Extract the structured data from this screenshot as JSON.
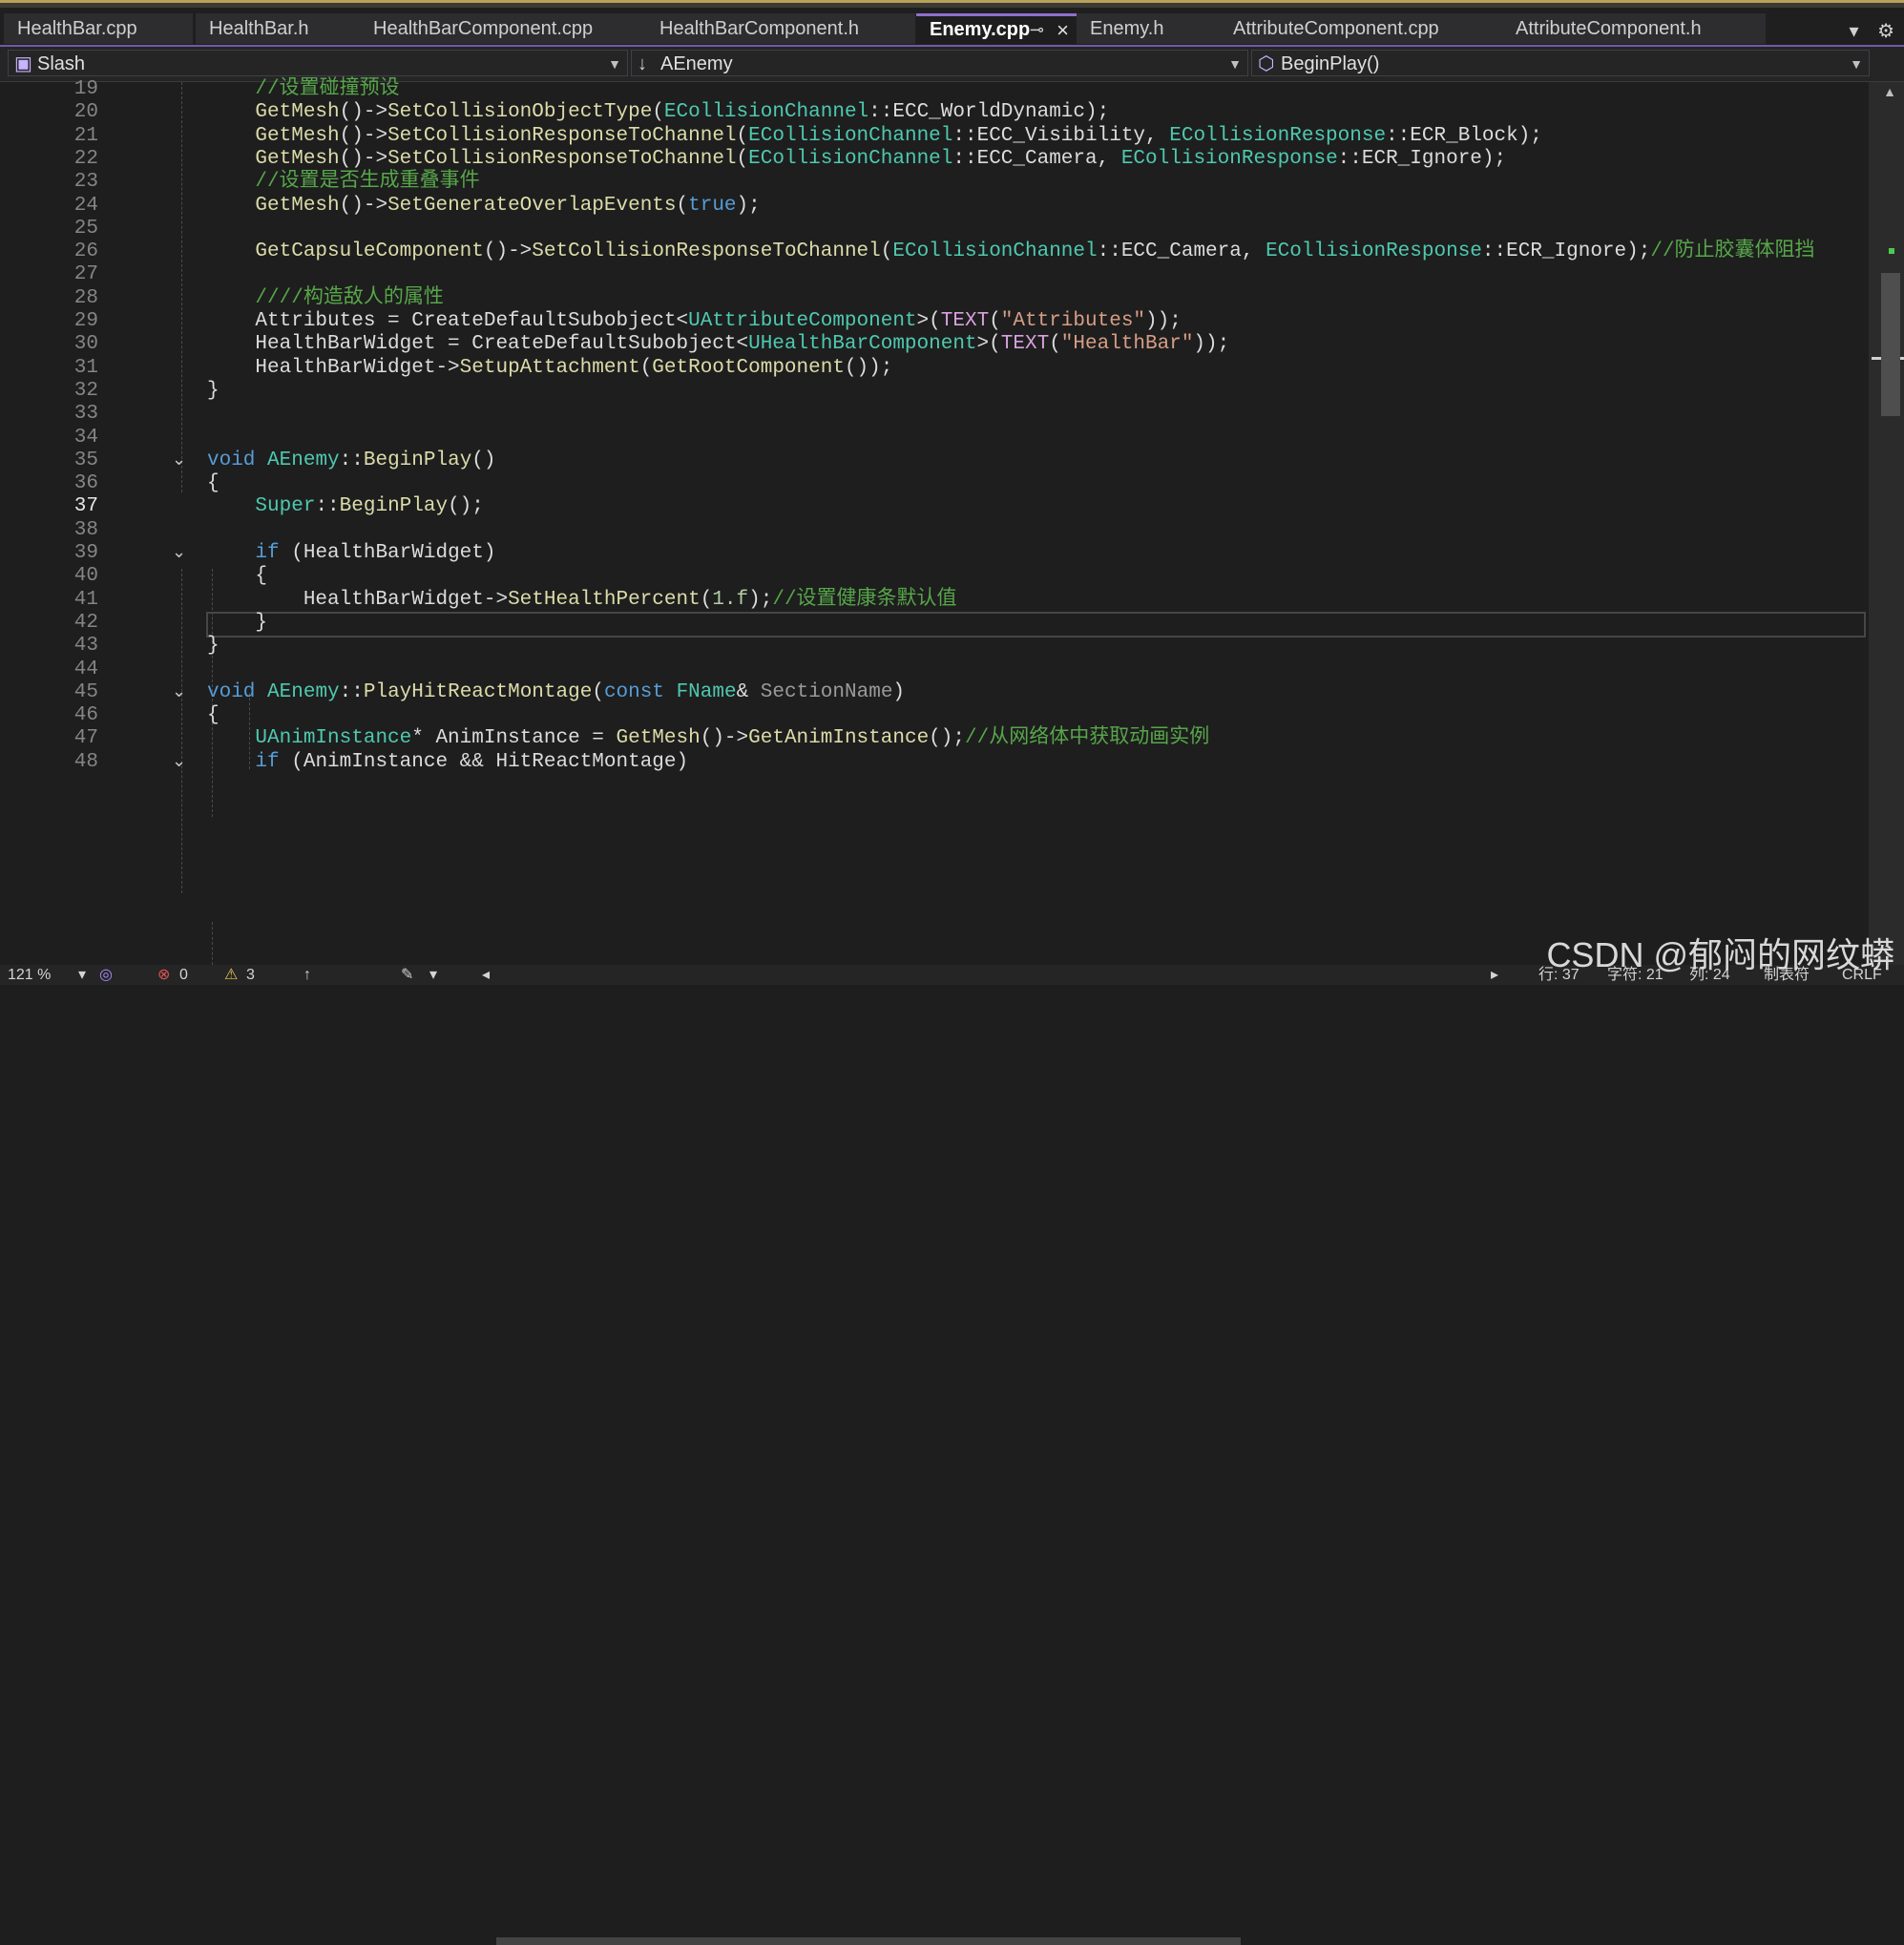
{
  "tabs": [
    {
      "label": "HealthBar.cpp"
    },
    {
      "label": "HealthBar.h"
    },
    {
      "label": "HealthBarComponent.cpp"
    },
    {
      "label": "HealthBarComponent.h"
    },
    {
      "label": "Enemy.cpp",
      "active": true
    },
    {
      "label": "Enemy.h"
    },
    {
      "label": "AttributeComponent.cpp"
    },
    {
      "label": "AttributeComponent.h"
    }
  ],
  "nav": {
    "project": "Slash",
    "scope": "AEnemy",
    "member": "BeginPlay()"
  },
  "code_lines": [
    {
      "n": "19",
      "text": "    //设置碰撞预设"
    },
    {
      "n": "20",
      "text": "    GetMesh()->SetCollisionObjectType(ECollisionChannel::ECC_WorldDynamic);"
    },
    {
      "n": "21",
      "text": "    GetMesh()->SetCollisionResponseToChannel(ECollisionChannel::ECC_Visibility, ECollisionResponse::ECR_Block);"
    },
    {
      "n": "22",
      "text": "    GetMesh()->SetCollisionResponseToChannel(ECollisionChannel::ECC_Camera, ECollisionResponse::ECR_Ignore);"
    },
    {
      "n": "23",
      "text": "    //设置是否生成重叠事件"
    },
    {
      "n": "24",
      "text": "    GetMesh()->SetGenerateOverlapEvents(true);"
    },
    {
      "n": "25",
      "text": ""
    },
    {
      "n": "26",
      "text": "    GetCapsuleComponent()->SetCollisionResponseToChannel(ECollisionChannel::ECC_Camera, ECollisionResponse::ECR_Ignore);//防止胶囊体阻挡"
    },
    {
      "n": "27",
      "text": ""
    },
    {
      "n": "28",
      "text": "    ////构造敌人的属性"
    },
    {
      "n": "29",
      "text": "    Attributes = CreateDefaultSubobject<UAttributeComponent>(TEXT(\"Attributes\"));"
    },
    {
      "n": "30",
      "text": "    HealthBarWidget = CreateDefaultSubobject<UHealthBarComponent>(TEXT(\"HealthBar\"));"
    },
    {
      "n": "31",
      "text": "    HealthBarWidget->SetupAttachment(GetRootComponent());"
    },
    {
      "n": "32",
      "text": "}"
    },
    {
      "n": "33",
      "text": ""
    },
    {
      "n": "34",
      "text": ""
    },
    {
      "n": "35",
      "text": "void AEnemy::BeginPlay()"
    },
    {
      "n": "36",
      "text": "{"
    },
    {
      "n": "37",
      "text": "    Super::BeginPlay();"
    },
    {
      "n": "38",
      "text": ""
    },
    {
      "n": "39",
      "text": "    if (HealthBarWidget)"
    },
    {
      "n": "40",
      "text": "    {"
    },
    {
      "n": "41",
      "text": "        HealthBarWidget->SetHealthPercent(1.f);//设置健康条默认值"
    },
    {
      "n": "42",
      "text": "    }"
    },
    {
      "n": "43",
      "text": "}"
    },
    {
      "n": "44",
      "text": ""
    },
    {
      "n": "45",
      "text": "void AEnemy::PlayHitReactMontage(const FName& SectionName)"
    },
    {
      "n": "46",
      "text": "{"
    },
    {
      "n": "47",
      "text": "    UAnimInstance* AnimInstance = GetMesh()->GetAnimInstance();//从网络体中获取动画实例"
    },
    {
      "n": "48",
      "text": "    if (AnimInstance && HitReactMontage)"
    }
  ],
  "status": {
    "zoom": "121 %",
    "errors": "0",
    "warnings": "3",
    "line": "行: 37",
    "char": "字符: 21",
    "col": "列: 24",
    "tabs": "制表符",
    "eol": "CRLF"
  },
  "watermark": "CSDN @郁闷的网纹蟒"
}
